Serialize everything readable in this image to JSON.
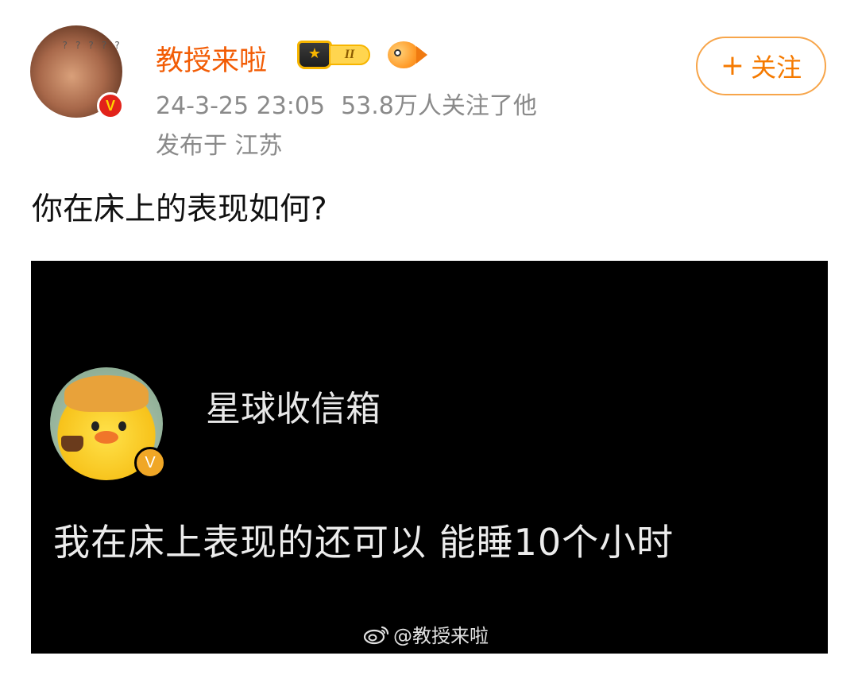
{
  "post": {
    "author": {
      "name": "教授来啦",
      "level_text": "II",
      "verified_mark": "V"
    },
    "timestamp": "24-3-25 23:05",
    "followers_text": "53.8万人关注了他",
    "location_text": "发布于 江苏",
    "follow_button": {
      "icon": "+",
      "label": "关注"
    },
    "content": "你在床上的表现如何?"
  },
  "media": {
    "account_name": "星球收信箱",
    "verified_mark": "V",
    "quote": "我在床上表现的还可以  能睡10个小时",
    "watermark": "@教授来啦"
  },
  "colors": {
    "username": "#f25c05",
    "meta": "#8a8a8a",
    "follow_border": "#f7a54a",
    "follow_text": "#f57a00",
    "media_bg": "#000000"
  },
  "icons": {
    "avatar_question_marks": "? ? ? ? ?",
    "crown": "★"
  }
}
